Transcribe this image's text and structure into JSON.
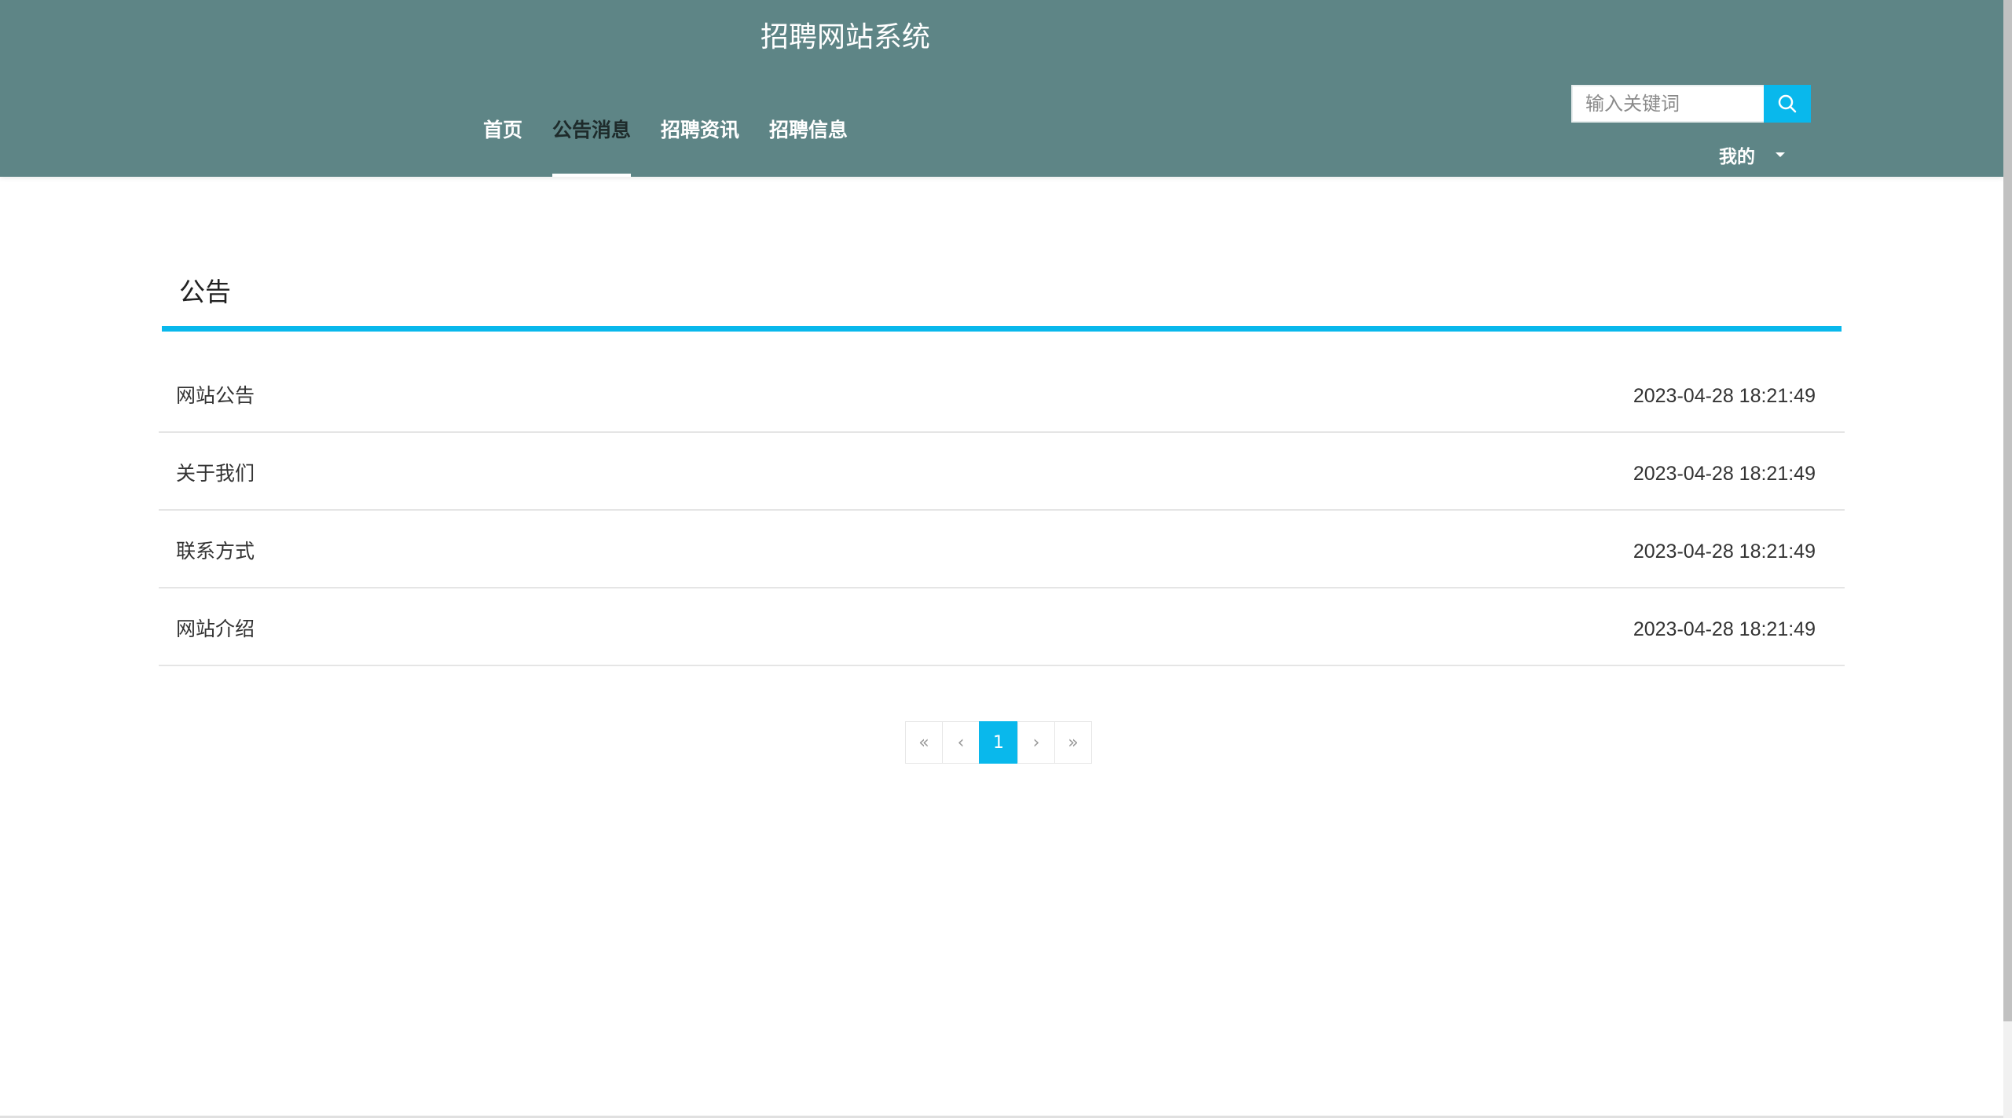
{
  "header": {
    "site_title": "招聘网站系统",
    "nav": [
      {
        "label": "首页",
        "active": false
      },
      {
        "label": "公告消息",
        "active": true
      },
      {
        "label": "招聘资讯",
        "active": false
      },
      {
        "label": "招聘信息",
        "active": false
      }
    ],
    "search": {
      "placeholder": "输入关键词",
      "icon": "search-icon"
    },
    "user_menu": {
      "label": "我的",
      "icon": "caret-down-icon"
    }
  },
  "main": {
    "section_title": "公告",
    "items": [
      {
        "title": "网站公告",
        "time": "2023-04-28 18:21:49"
      },
      {
        "title": "关于我们",
        "time": "2023-04-28 18:21:49"
      },
      {
        "title": "联系方式",
        "time": "2023-04-28 18:21:49"
      },
      {
        "title": "网站介绍",
        "time": "2023-04-28 18:21:49"
      }
    ]
  },
  "pagination": {
    "first": "«",
    "prev": "‹",
    "current": "1",
    "next": "›",
    "last": "»"
  },
  "colors": {
    "header_bg": "#5e8586",
    "accent": "#09b8ec"
  }
}
